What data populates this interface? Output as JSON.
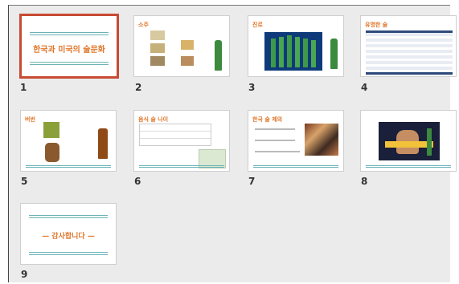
{
  "slides": [
    {
      "number": "1",
      "title": "한국과 미국의 술문화",
      "selected": true
    },
    {
      "number": "2",
      "title": "소주"
    },
    {
      "number": "3",
      "title": "진로"
    },
    {
      "number": "4",
      "title": "유명한 술"
    },
    {
      "number": "5",
      "title": "버번"
    },
    {
      "number": "6",
      "title": "음식 술 나이"
    },
    {
      "number": "7",
      "title": "한국 술 제의"
    },
    {
      "number": "8",
      "title": ""
    },
    {
      "number": "9",
      "title": "— 감사합니다 —"
    }
  ],
  "colors": {
    "accent": "#e0762a",
    "teal": "#6bb3b7",
    "selection": "#c84a33"
  }
}
